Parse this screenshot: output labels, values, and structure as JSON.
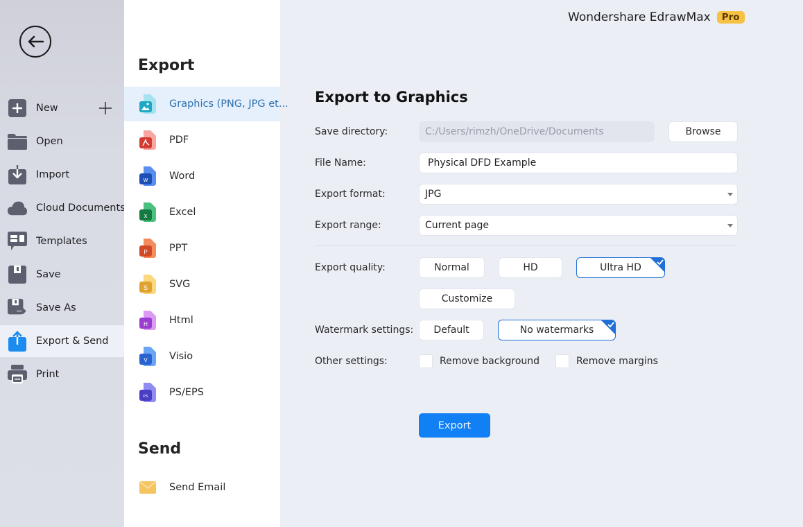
{
  "app": {
    "brand_name": "Wondershare EdrawMax",
    "badge": "Pro"
  },
  "leftnav": {
    "back_icon": "back-arrow-icon",
    "items": [
      {
        "label": "New",
        "icon": "plus-square-icon"
      },
      {
        "label": "Open",
        "icon": "folder-icon"
      },
      {
        "label": "Import",
        "icon": "import-icon"
      },
      {
        "label": "Cloud Documents",
        "icon": "cloud-icon"
      },
      {
        "label": "Templates",
        "icon": "templates-icon"
      },
      {
        "label": "Save",
        "icon": "save-icon"
      },
      {
        "label": "Save As",
        "icon": "save-as-icon"
      },
      {
        "label": "Export & Send",
        "icon": "export-icon",
        "active": true
      },
      {
        "label": "Print",
        "icon": "print-icon"
      }
    ]
  },
  "export_panel": {
    "title": "Export",
    "formats": [
      {
        "label": "Graphics (PNG, JPG et...",
        "icon": "image-file-icon",
        "active": true
      },
      {
        "label": "PDF",
        "icon": "pdf-file-icon"
      },
      {
        "label": "Word",
        "icon": "word-file-icon"
      },
      {
        "label": "Excel",
        "icon": "excel-file-icon"
      },
      {
        "label": "PPT",
        "icon": "ppt-file-icon"
      },
      {
        "label": "SVG",
        "icon": "svg-file-icon"
      },
      {
        "label": "Html",
        "icon": "html-file-icon"
      },
      {
        "label": "Visio",
        "icon": "visio-file-icon"
      },
      {
        "label": "PS/EPS",
        "icon": "ps-file-icon"
      }
    ],
    "send_title": "Send",
    "send_items": [
      {
        "label": "Send Email",
        "icon": "email-icon"
      }
    ]
  },
  "form": {
    "title": "Export to Graphics",
    "save_directory": {
      "label": "Save directory:",
      "value": "C:/Users/rimzh/OneDrive/Documents",
      "browse_label": "Browse"
    },
    "file_name": {
      "label": "File Name:",
      "value": "Physical DFD Example"
    },
    "export_format": {
      "label": "Export format:",
      "value": "JPG"
    },
    "export_range": {
      "label": "Export range:",
      "value": "Current page"
    },
    "export_quality": {
      "label": "Export quality:",
      "options": [
        "Normal",
        "HD",
        "Ultra HD",
        "Customize"
      ],
      "selected": "Ultra HD"
    },
    "watermark": {
      "label": "Watermark settings:",
      "options": [
        "Default",
        "No watermarks"
      ],
      "selected": "No watermarks"
    },
    "other": {
      "label": "Other settings:",
      "remove_background": {
        "label": "Remove background",
        "checked": false
      },
      "remove_margins": {
        "label": "Remove margins",
        "checked": false
      }
    },
    "export_button": "Export"
  },
  "colors": {
    "accent": "#1180f5",
    "selected_border": "#1f6fd6",
    "pro_badge": "#f6c245"
  }
}
